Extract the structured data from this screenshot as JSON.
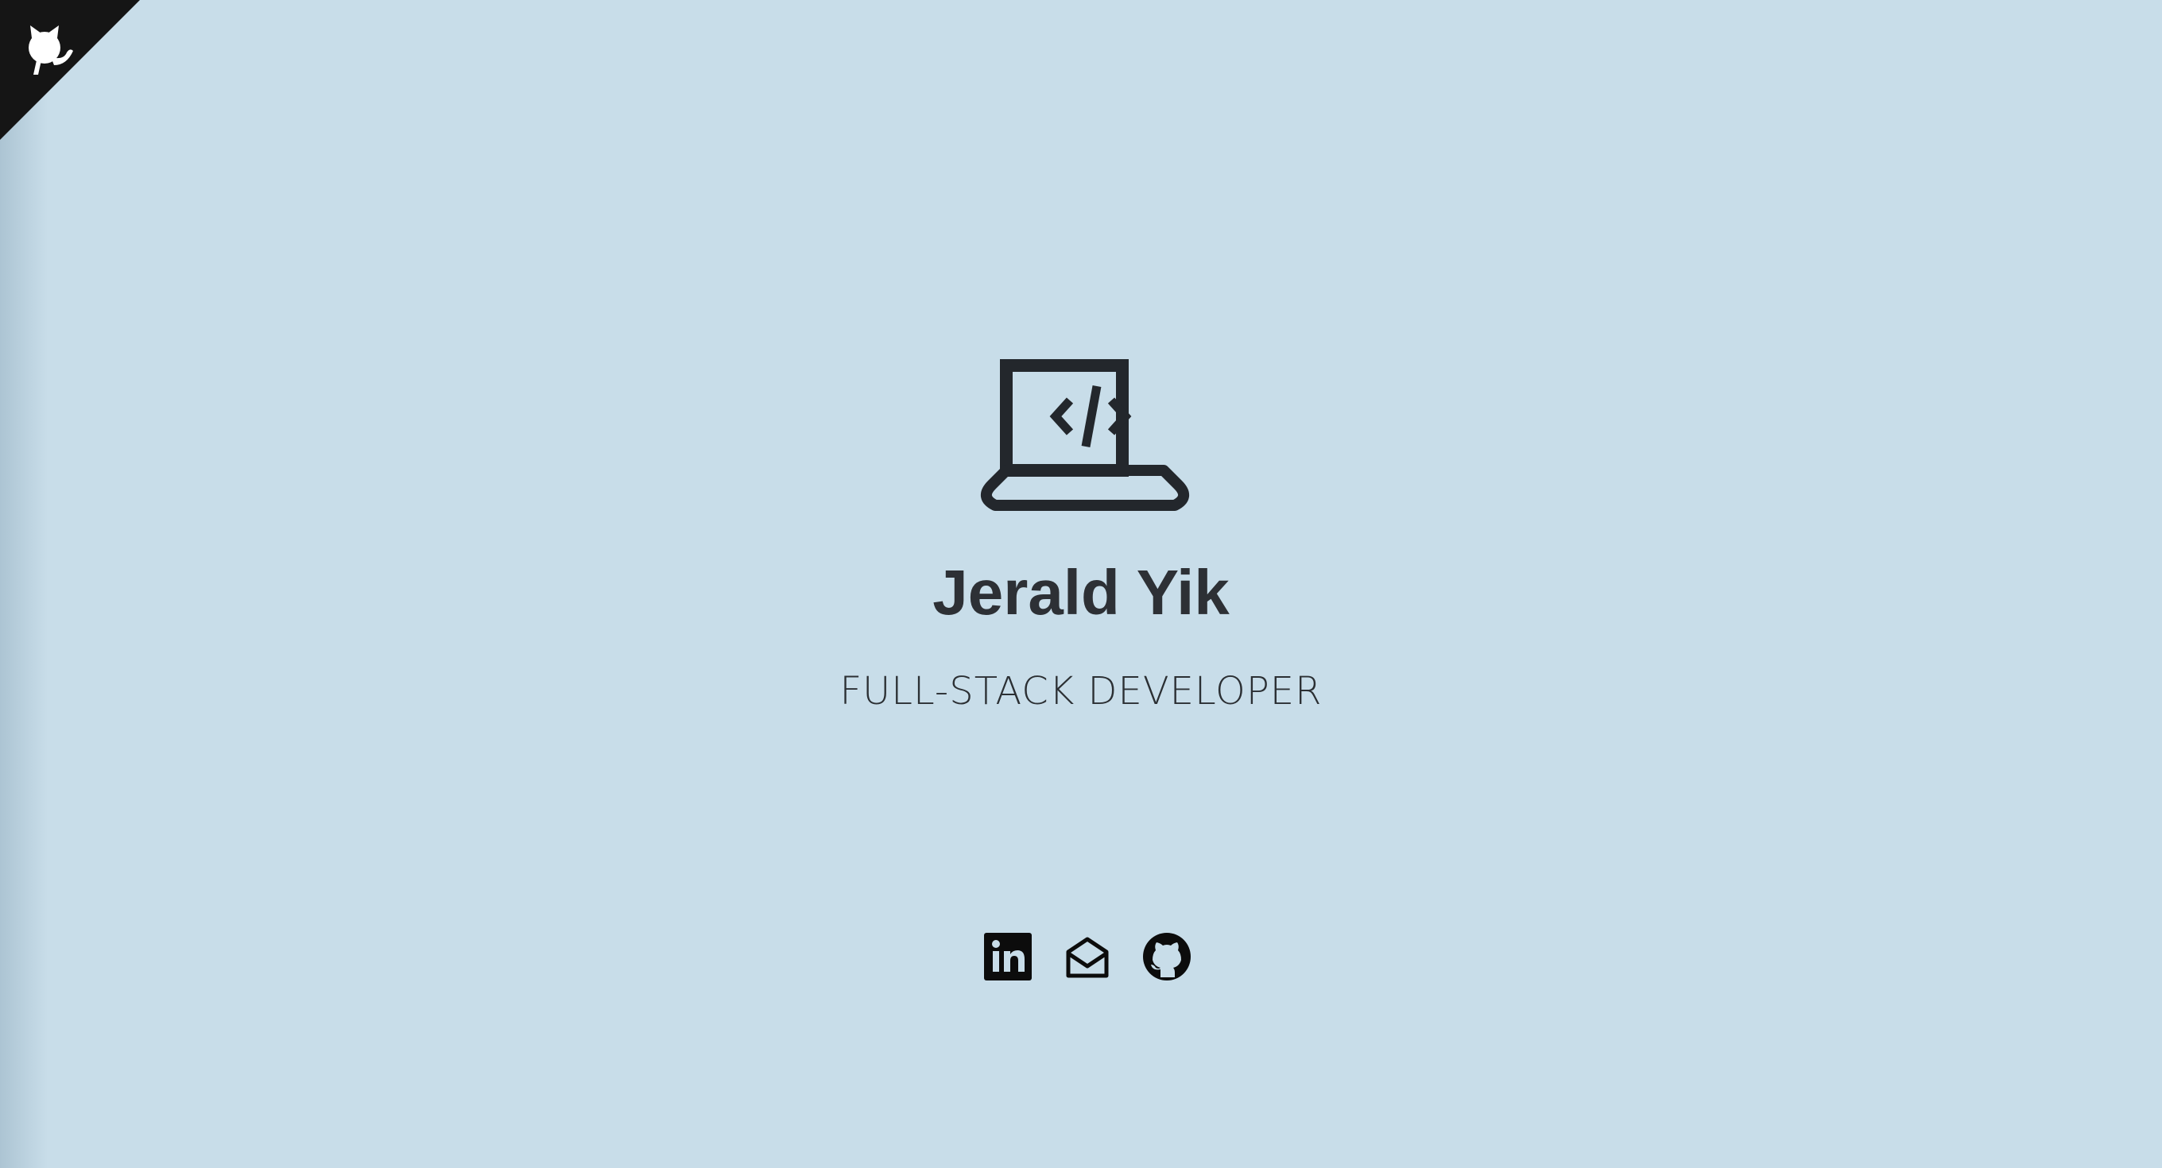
{
  "profile": {
    "name": "Jerald Yik",
    "role": "FULL-STACK DEVELOPER"
  },
  "icons": {
    "corner": "github-octocat-icon",
    "hero": "laptop-code-icon",
    "socials": [
      "linkedin-icon",
      "mail-open-icon",
      "github-icon"
    ]
  },
  "colors": {
    "background": "#c8dde9",
    "text": "#2d3035",
    "corner_banner": "#151515"
  }
}
